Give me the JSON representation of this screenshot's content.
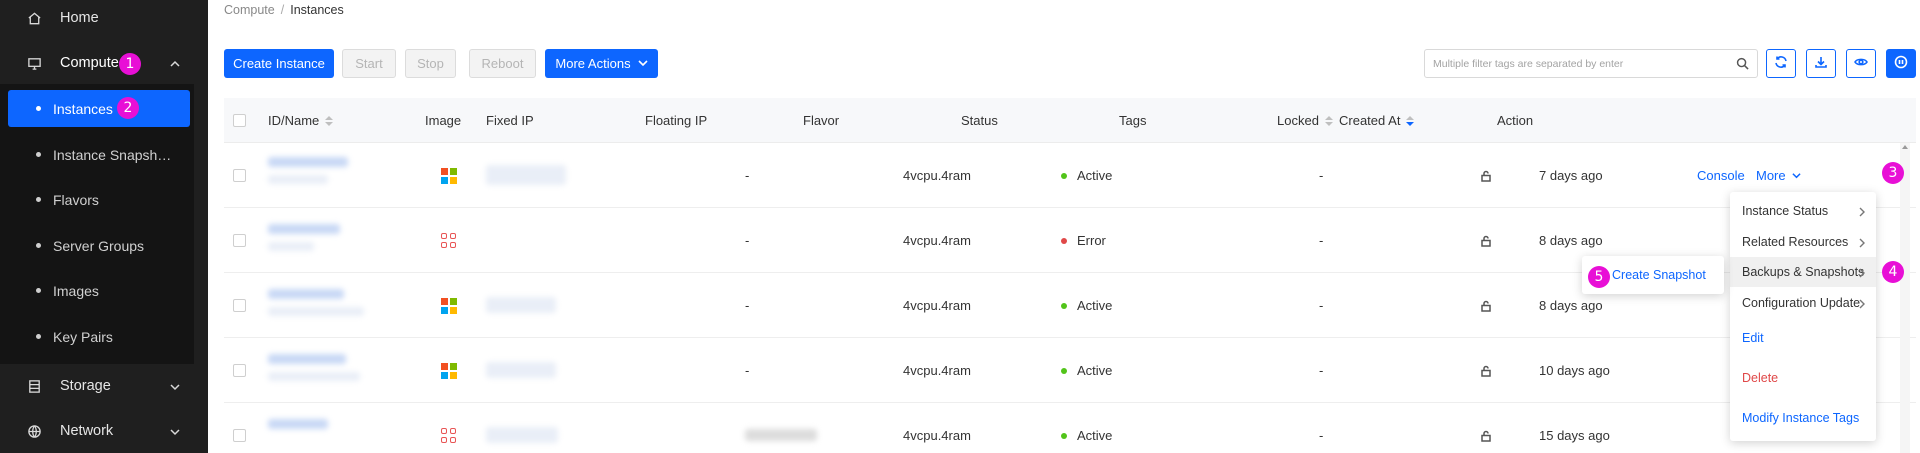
{
  "sidebar": {
    "home": "Home",
    "compute": "Compute",
    "storage": "Storage",
    "network": "Network",
    "sub_items": [
      "Instances",
      "Instance Snapsh…",
      "Flavors",
      "Server Groups",
      "Images",
      "Key Pairs"
    ]
  },
  "badges": [
    "1",
    "2",
    "3",
    "4",
    "5"
  ],
  "breadcrumb": {
    "parent": "Compute",
    "separator": "/",
    "current": "Instances"
  },
  "toolbar": {
    "create": "Create Instance",
    "start": "Start",
    "stop": "Stop",
    "reboot": "Reboot",
    "more_actions": "More Actions"
  },
  "search": {
    "placeholder": "Multiple filter tags are separated by enter"
  },
  "table": {
    "headers": {
      "id_name": "ID/Name",
      "image": "Image",
      "fixed_ip": "Fixed IP",
      "floating_ip": "Floating IP",
      "flavor": "Flavor",
      "status": "Status",
      "tags": "Tags",
      "locked": "Locked",
      "created_at": "Created At",
      "action": "Action"
    },
    "rows": [
      {
        "image": "windows",
        "floating_ip": "-",
        "flavor": "4vcpu.4ram",
        "status": "Active",
        "status_color": "#52c41a",
        "tags": "-",
        "created": "7 days ago"
      },
      {
        "image": "linux",
        "floating_ip": "-",
        "flavor": "4vcpu.4ram",
        "status": "Error",
        "status_color": "#e04848",
        "tags": "-",
        "created": "8 days ago"
      },
      {
        "image": "windows",
        "floating_ip": "-",
        "flavor": "4vcpu.4ram",
        "status": "Active",
        "status_color": "#52c41a",
        "tags": "-",
        "created": "8 days ago"
      },
      {
        "image": "windows",
        "floating_ip": "-",
        "flavor": "4vcpu.4ram",
        "status": "Active",
        "status_color": "#52c41a",
        "tags": "-",
        "created": "10 days ago"
      },
      {
        "image": "linux",
        "floating_ip": "",
        "flavor": "4vcpu.4ram",
        "status": "Active",
        "status_color": "#52c41a",
        "tags": "-",
        "created": "15 days ago"
      }
    ],
    "console": "Console",
    "more": "More"
  },
  "dropdown": {
    "instance_status": "Instance Status",
    "related_resources": "Related Resources",
    "backups_snapshots": "Backups & Snapshots",
    "configuration_update": "Configuration Update",
    "edit": "Edit",
    "delete": "Delete",
    "modify_tags": "Modify Instance Tags"
  },
  "submenu": {
    "create_snapshot": "Create Snapshot"
  },
  "colors": {
    "primary": "#0d66ff",
    "badge": "#e80fd6",
    "active": "#52c41a",
    "error": "#e04848",
    "sidebar": "#1f1f1f"
  }
}
